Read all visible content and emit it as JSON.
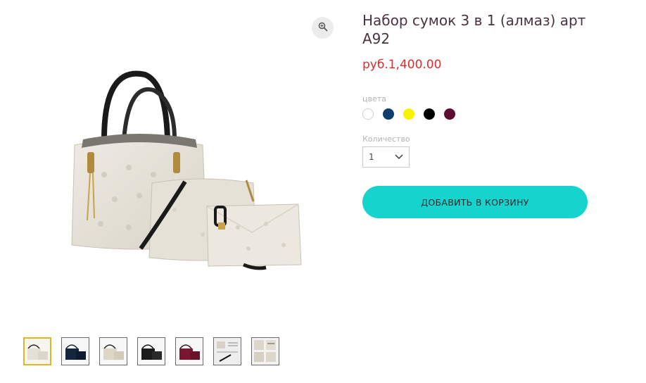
{
  "product": {
    "title": "Набор сумок 3 в 1 (алмаз) арт A92",
    "price": "руб.1,400.00"
  },
  "colors": {
    "label": "цвета",
    "options": [
      {
        "name": "white",
        "hex": "#ffffff"
      },
      {
        "name": "navy",
        "hex": "#0f3d6b"
      },
      {
        "name": "yellow",
        "hex": "#f6f200"
      },
      {
        "name": "black",
        "hex": "#000000"
      },
      {
        "name": "burgundy",
        "hex": "#5c0f33"
      }
    ]
  },
  "quantity": {
    "label": "Количество",
    "value": "1"
  },
  "actions": {
    "add_to_cart": "ДОБАВИТЬ В КОРЗИНУ"
  },
  "icons": {
    "zoom": "zoom-icon",
    "dropdown": "chevron-down-icon"
  },
  "thumbnails": [
    {
      "name": "beige-set",
      "selected": true
    },
    {
      "name": "navy-set",
      "selected": false
    },
    {
      "name": "beige-set-2",
      "selected": false
    },
    {
      "name": "black-set",
      "selected": false
    },
    {
      "name": "burgundy-set",
      "selected": false
    },
    {
      "name": "size-chart",
      "selected": false
    },
    {
      "name": "detail-view",
      "selected": false
    }
  ]
}
